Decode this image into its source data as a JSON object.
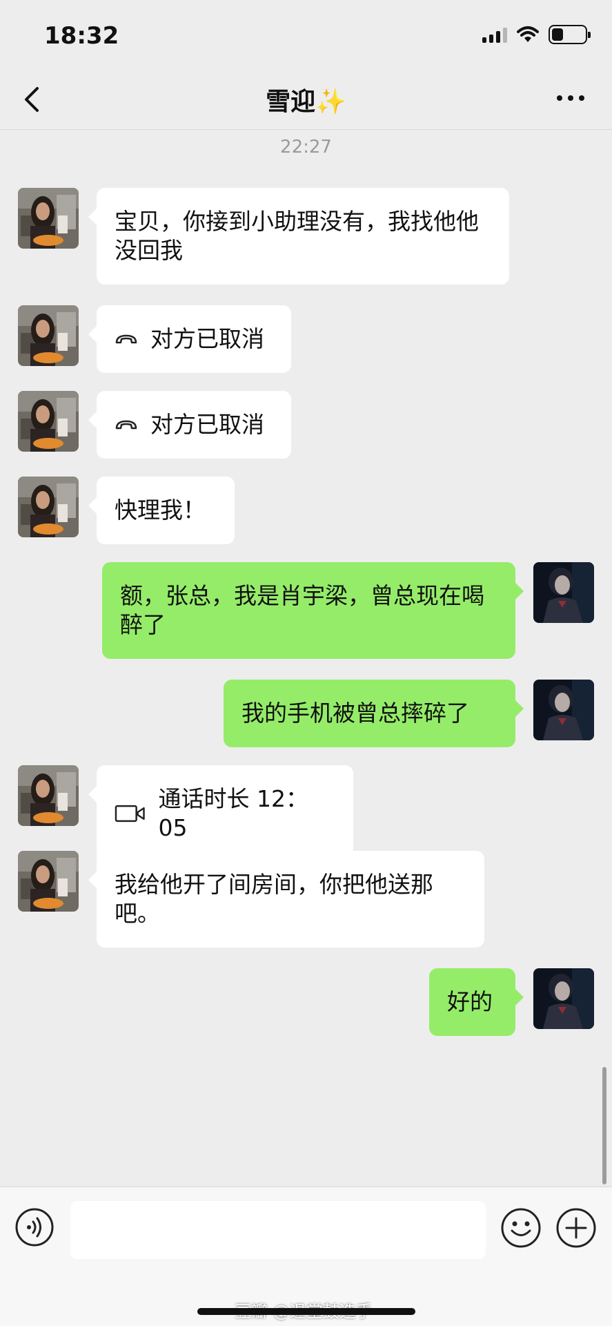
{
  "status_bar": {
    "time": "18:32",
    "icons": [
      "signal-icon",
      "wifi-icon",
      "battery-icon"
    ],
    "battery_level": 0.35
  },
  "header": {
    "title": "雪迎✨",
    "back_icon": "chevron-left-icon",
    "more_icon": "more-dots-icon"
  },
  "timestamp": "22:27",
  "messages": [
    {
      "from": "contact",
      "type": "text",
      "text": "宝贝，你接到小助理没有，我找他他没回我"
    },
    {
      "from": "contact",
      "type": "call",
      "icon": "phone-hangup-icon",
      "text": "对方已取消"
    },
    {
      "from": "contact",
      "type": "call",
      "icon": "phone-hangup-icon",
      "text": "对方已取消"
    },
    {
      "from": "contact",
      "type": "text",
      "text": "快理我！"
    },
    {
      "from": "me",
      "type": "text",
      "text": "额，张总，我是肖宇梁，曾总现在喝醉了"
    },
    {
      "from": "me",
      "type": "text",
      "text": "我的手机被曾总摔碎了"
    },
    {
      "from": "contact",
      "type": "call",
      "icon": "video-call-icon",
      "text": "通话时长 12：05"
    },
    {
      "from": "contact",
      "type": "text",
      "text": "我给他开了间房间，你把他送那吧。"
    },
    {
      "from": "me",
      "type": "text",
      "text": "好的"
    }
  ],
  "input_bar": {
    "value": "",
    "icons": [
      "voice-icon",
      "emoji-icon",
      "plus-icon"
    ]
  },
  "watermark": "豆瓣 @退堂鼓选手",
  "colors": {
    "background": "#ededed",
    "me_bubble": "#95ec69",
    "contact_bubble": "#ffffff"
  }
}
